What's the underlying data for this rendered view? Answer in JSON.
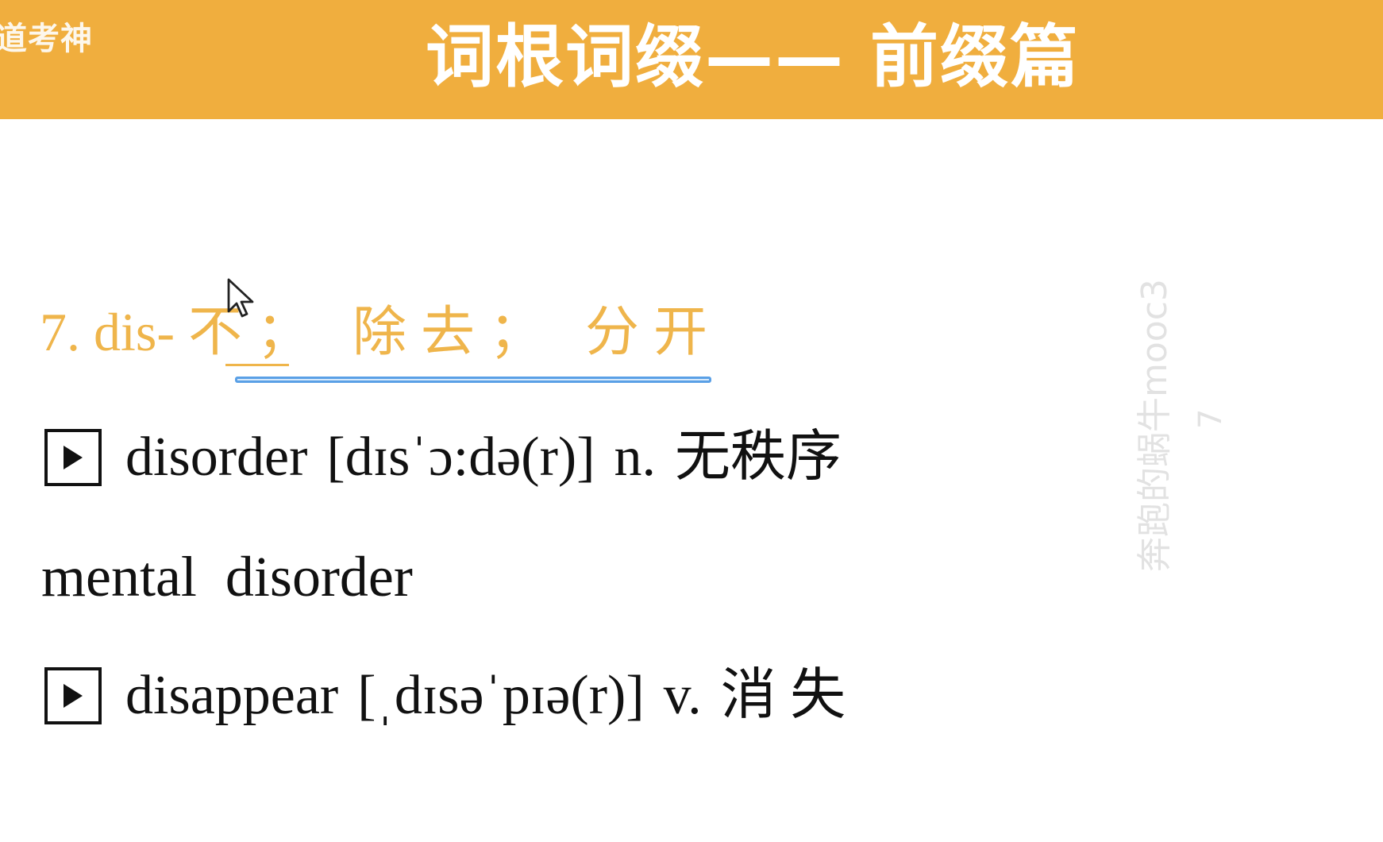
{
  "header": {
    "corner_logo": "道考神",
    "title": "词根词缀—— 前缀篇",
    "background_color": "#f0ae3e"
  },
  "section": {
    "number": "7.",
    "prefix": "dis-",
    "meaning": "不； 除去； 分开",
    "color": "#efb54b"
  },
  "entries": [
    {
      "icon": "play-icon",
      "word": "disorder",
      "phonetic": "[dɪsˈɔ:də(r)]",
      "pos": "n.",
      "meaning": "无秩序"
    },
    {
      "icon": "play-icon",
      "word": "disappear",
      "phonetic": "[ˌdɪsəˈpɪə(r)]",
      "pos": "v.",
      "meaning": "消 失"
    }
  ],
  "phrase": "mental  disorder",
  "watermark": {
    "text": "奔跑的蜗牛mooc3",
    "sub": "7"
  },
  "cursor": "mouse-pointer-icon"
}
